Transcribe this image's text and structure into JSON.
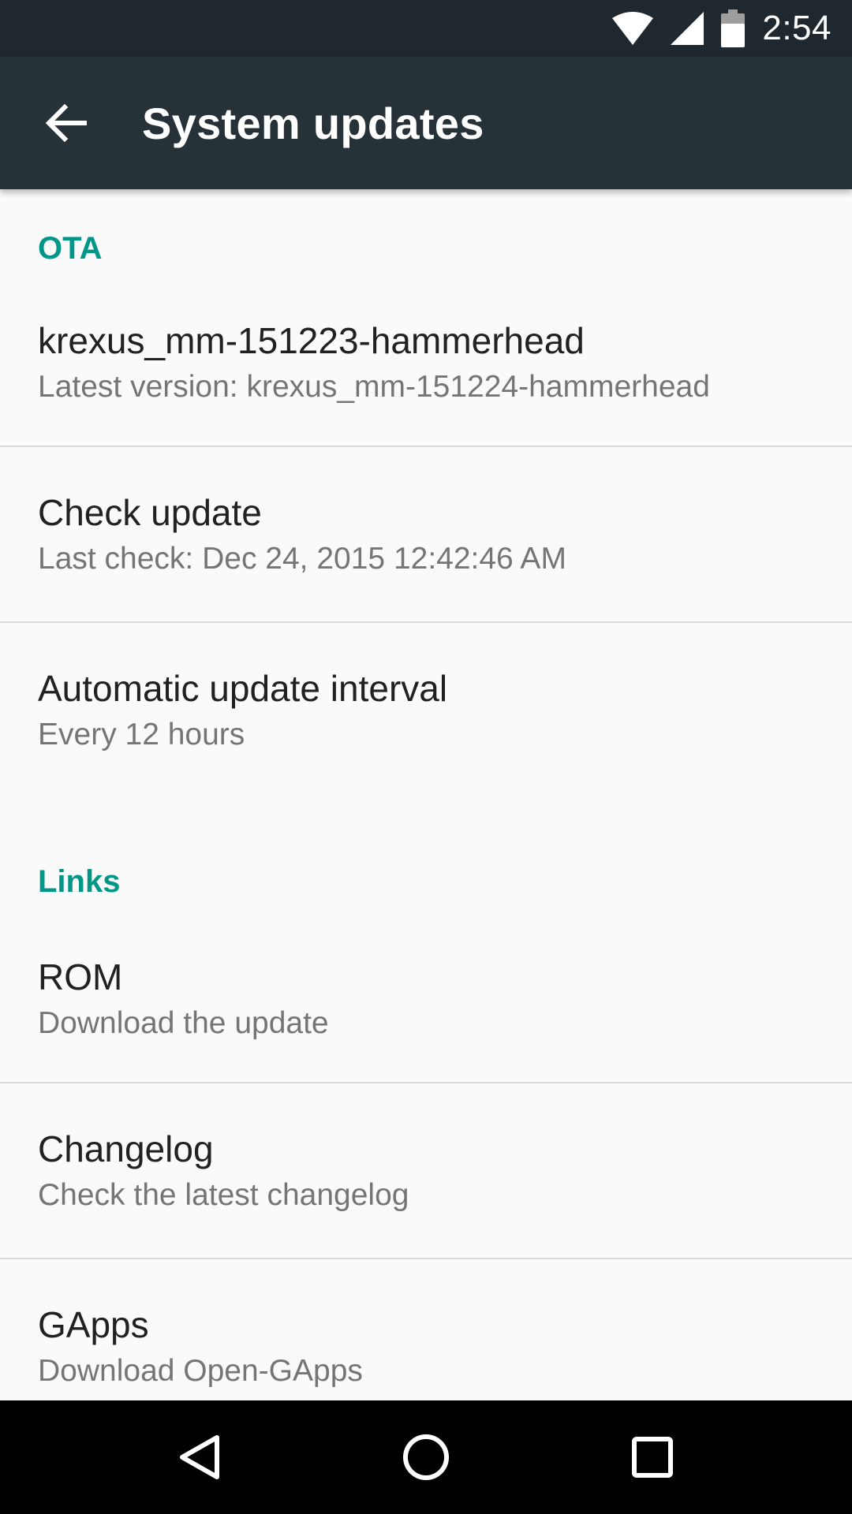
{
  "status_bar": {
    "time": "2:54",
    "icons": [
      "wifi-icon",
      "cell-signal-icon",
      "battery-icon"
    ]
  },
  "toolbar": {
    "back_icon": "arrow-back-icon",
    "title": "System updates"
  },
  "sections": [
    {
      "header": "OTA",
      "items": [
        {
          "title": "krexus_mm-151223-hammerhead",
          "summary": "Latest version: krexus_mm-151224-hammerhead"
        },
        {
          "title": "Check update",
          "summary": "Last check: Dec 24, 2015 12:42:46 AM"
        },
        {
          "title": "Automatic update interval",
          "summary": "Every 12 hours"
        }
      ]
    },
    {
      "header": "Links",
      "items": [
        {
          "title": "ROM",
          "summary": "Download the update"
        },
        {
          "title": "Changelog",
          "summary": "Check the latest changelog"
        },
        {
          "title": "GApps",
          "summary": "Download Open-GApps"
        }
      ]
    }
  ],
  "nav_bar": {
    "icons": [
      "back-triangle-icon",
      "home-circle-icon",
      "recents-square-icon"
    ]
  },
  "colors": {
    "status_bar": "#1f282e",
    "toolbar": "#263238",
    "accent": "#009688",
    "background": "#fafafa"
  }
}
